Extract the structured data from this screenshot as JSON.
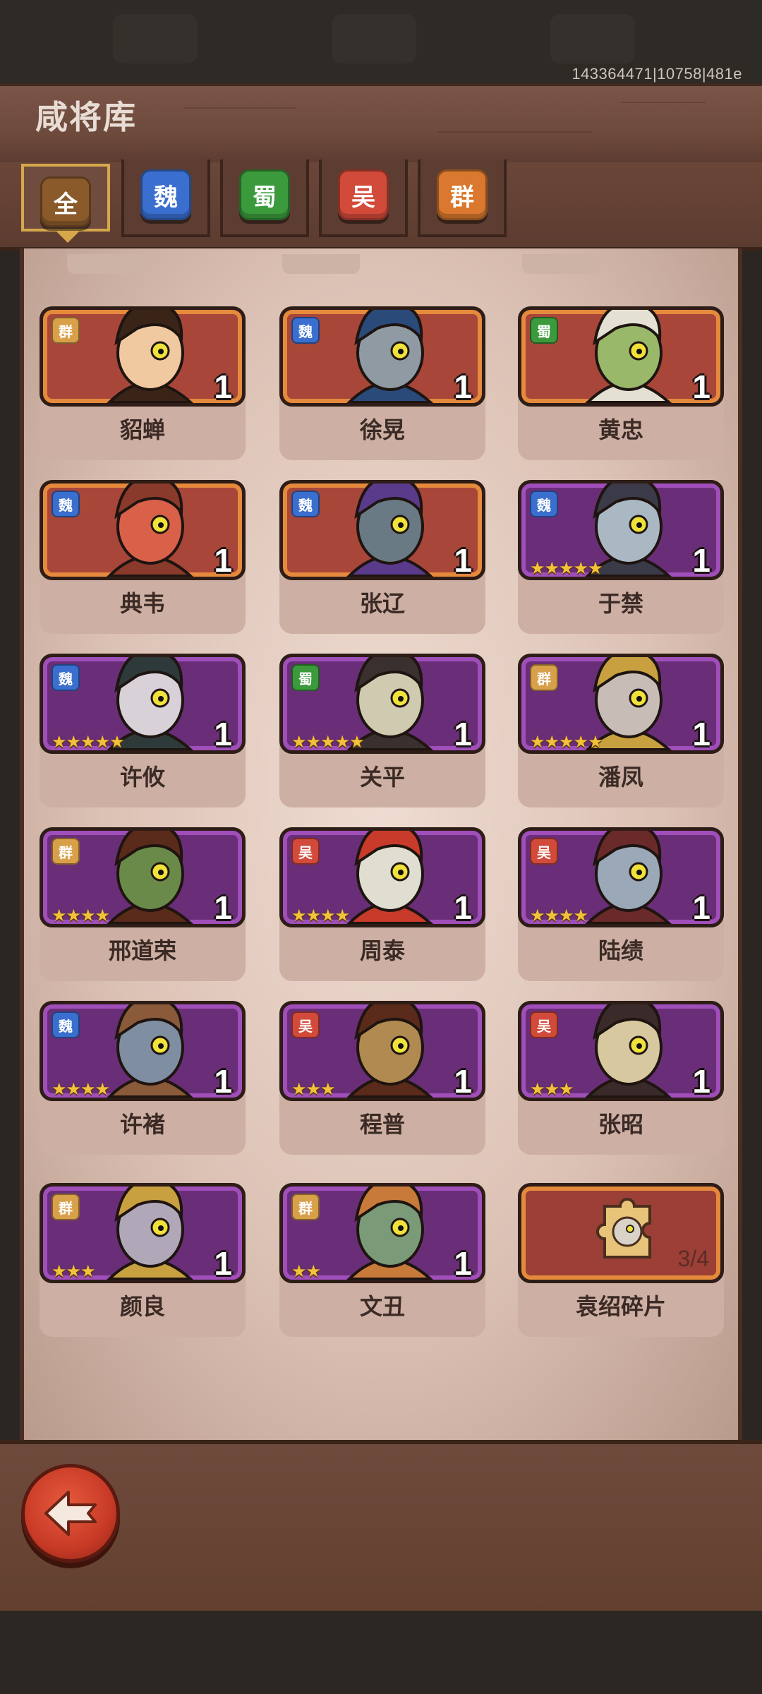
{
  "header": {
    "build_id": "143364471|10758|481e",
    "title": "咸将库"
  },
  "tabs": [
    {
      "label": "全",
      "color": "#8a5a2b",
      "active": true
    },
    {
      "label": "魏",
      "color": "#3a6fd0",
      "active": false
    },
    {
      "label": "蜀",
      "color": "#3b9a3b",
      "active": false
    },
    {
      "label": "吴",
      "color": "#d24a3a",
      "active": false
    },
    {
      "label": "群",
      "color": "#d9782e",
      "active": false
    }
  ],
  "heroes": [
    {
      "name": "貂蝉",
      "faction": "群",
      "faction_color": "#d9a04a",
      "level": "1",
      "stars": 0,
      "frame": "orange"
    },
    {
      "name": "徐晃",
      "faction": "魏",
      "faction_color": "#3a6fd0",
      "level": "1",
      "stars": 0,
      "frame": "orange"
    },
    {
      "name": "黄忠",
      "faction": "蜀",
      "faction_color": "#3b9a3b",
      "level": "1",
      "stars": 0,
      "frame": "orange"
    },
    {
      "name": "典韦",
      "faction": "魏",
      "faction_color": "#3a6fd0",
      "level": "1",
      "stars": 0,
      "frame": "orange"
    },
    {
      "name": "张辽",
      "faction": "魏",
      "faction_color": "#3a6fd0",
      "level": "1",
      "stars": 0,
      "frame": "orange"
    },
    {
      "name": "于禁",
      "faction": "魏",
      "faction_color": "#3a6fd0",
      "level": "1",
      "stars": 5,
      "frame": "purple"
    },
    {
      "name": "许攸",
      "faction": "魏",
      "faction_color": "#3a6fd0",
      "level": "1",
      "stars": 5,
      "frame": "purple"
    },
    {
      "name": "关平",
      "faction": "蜀",
      "faction_color": "#3b9a3b",
      "level": "1",
      "stars": 5,
      "frame": "purple"
    },
    {
      "name": "潘凤",
      "faction": "群",
      "faction_color": "#d9a04a",
      "level": "1",
      "stars": 5,
      "frame": "purple"
    },
    {
      "name": "邢道荣",
      "faction": "群",
      "faction_color": "#d9a04a",
      "level": "1",
      "stars": 4,
      "frame": "purple"
    },
    {
      "name": "周泰",
      "faction": "吴",
      "faction_color": "#d24a3a",
      "level": "1",
      "stars": 4,
      "frame": "purple"
    },
    {
      "name": "陆绩",
      "faction": "吴",
      "faction_color": "#d24a3a",
      "level": "1",
      "stars": 4,
      "frame": "purple"
    },
    {
      "name": "许褚",
      "faction": "魏",
      "faction_color": "#3a6fd0",
      "level": "1",
      "stars": 4,
      "frame": "purple"
    },
    {
      "name": "程普",
      "faction": "吴",
      "faction_color": "#d24a3a",
      "level": "1",
      "stars": 3,
      "frame": "purple"
    },
    {
      "name": "张昭",
      "faction": "吴",
      "faction_color": "#d24a3a",
      "level": "1",
      "stars": 3,
      "frame": "purple"
    },
    {
      "name": "颜良",
      "faction": "群",
      "faction_color": "#d9a04a",
      "level": "1",
      "stars": 3,
      "frame": "purple"
    },
    {
      "name": "文丑",
      "faction": "群",
      "faction_color": "#d9a04a",
      "level": "1",
      "stars": 2,
      "frame": "purple"
    }
  ],
  "fragment": {
    "name": "袁绍碎片",
    "count": "3/4"
  },
  "footer": {
    "back_icon": "back-arrow-icon"
  }
}
